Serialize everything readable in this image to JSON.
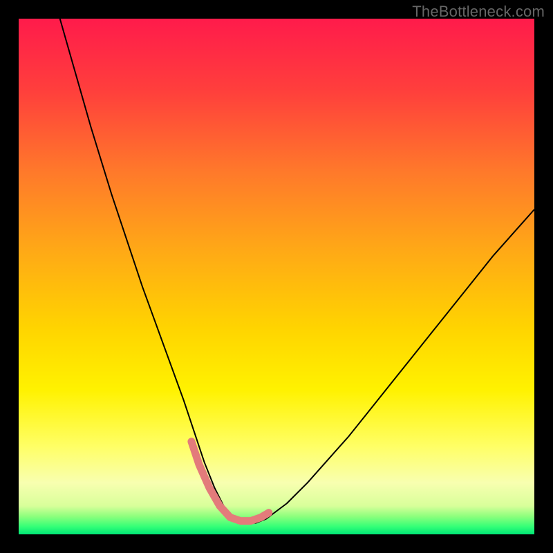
{
  "watermark": "TheBottleneck.com",
  "chart_data": {
    "type": "line",
    "title": "",
    "xlabel": "",
    "ylabel": "",
    "xlim": [
      0,
      100
    ],
    "ylim": [
      0,
      100
    ],
    "grid": false,
    "legend": false,
    "background_gradient": {
      "stops": [
        {
          "offset": 0.0,
          "color": "#ff1b4b"
        },
        {
          "offset": 0.14,
          "color": "#ff3f3c"
        },
        {
          "offset": 0.3,
          "color": "#ff7a2a"
        },
        {
          "offset": 0.45,
          "color": "#ffa916"
        },
        {
          "offset": 0.6,
          "color": "#ffd400"
        },
        {
          "offset": 0.72,
          "color": "#fff200"
        },
        {
          "offset": 0.83,
          "color": "#ffff66"
        },
        {
          "offset": 0.9,
          "color": "#f8ffb0"
        },
        {
          "offset": 0.945,
          "color": "#d8ff9a"
        },
        {
          "offset": 0.965,
          "color": "#8dff7d"
        },
        {
          "offset": 0.985,
          "color": "#34ff77"
        },
        {
          "offset": 1.0,
          "color": "#00e676"
        }
      ]
    },
    "series": [
      {
        "name": "bottleneck-curve",
        "stroke": "#000000",
        "stroke_width": 2,
        "x": [
          8.0,
          10,
          12,
          14,
          16,
          18,
          20,
          22,
          24,
          26,
          28,
          30,
          32,
          33,
          34,
          36,
          38,
          40,
          42,
          44,
          46,
          48,
          52,
          56,
          60,
          64,
          68,
          72,
          76,
          80,
          84,
          88,
          92,
          96,
          100
        ],
        "y": [
          100,
          93,
          86,
          79,
          72.5,
          66,
          60,
          54,
          48,
          42.5,
          37,
          31.5,
          26,
          23,
          20,
          14,
          9,
          5,
          3,
          2.2,
          2.2,
          3,
          6,
          10,
          14.5,
          19,
          24,
          29,
          34,
          39,
          44,
          49,
          54,
          58.5,
          63
        ]
      },
      {
        "name": "highlight-band",
        "stroke": "#e37b7b",
        "stroke_width": 11,
        "linecap": "round",
        "x": [
          33.5,
          35,
          37,
          39,
          41,
          43,
          45,
          47,
          48.5
        ],
        "y": [
          18,
          13.5,
          9,
          5.5,
          3.3,
          2.6,
          2.6,
          3.3,
          4.2
        ]
      }
    ],
    "annotations": []
  }
}
